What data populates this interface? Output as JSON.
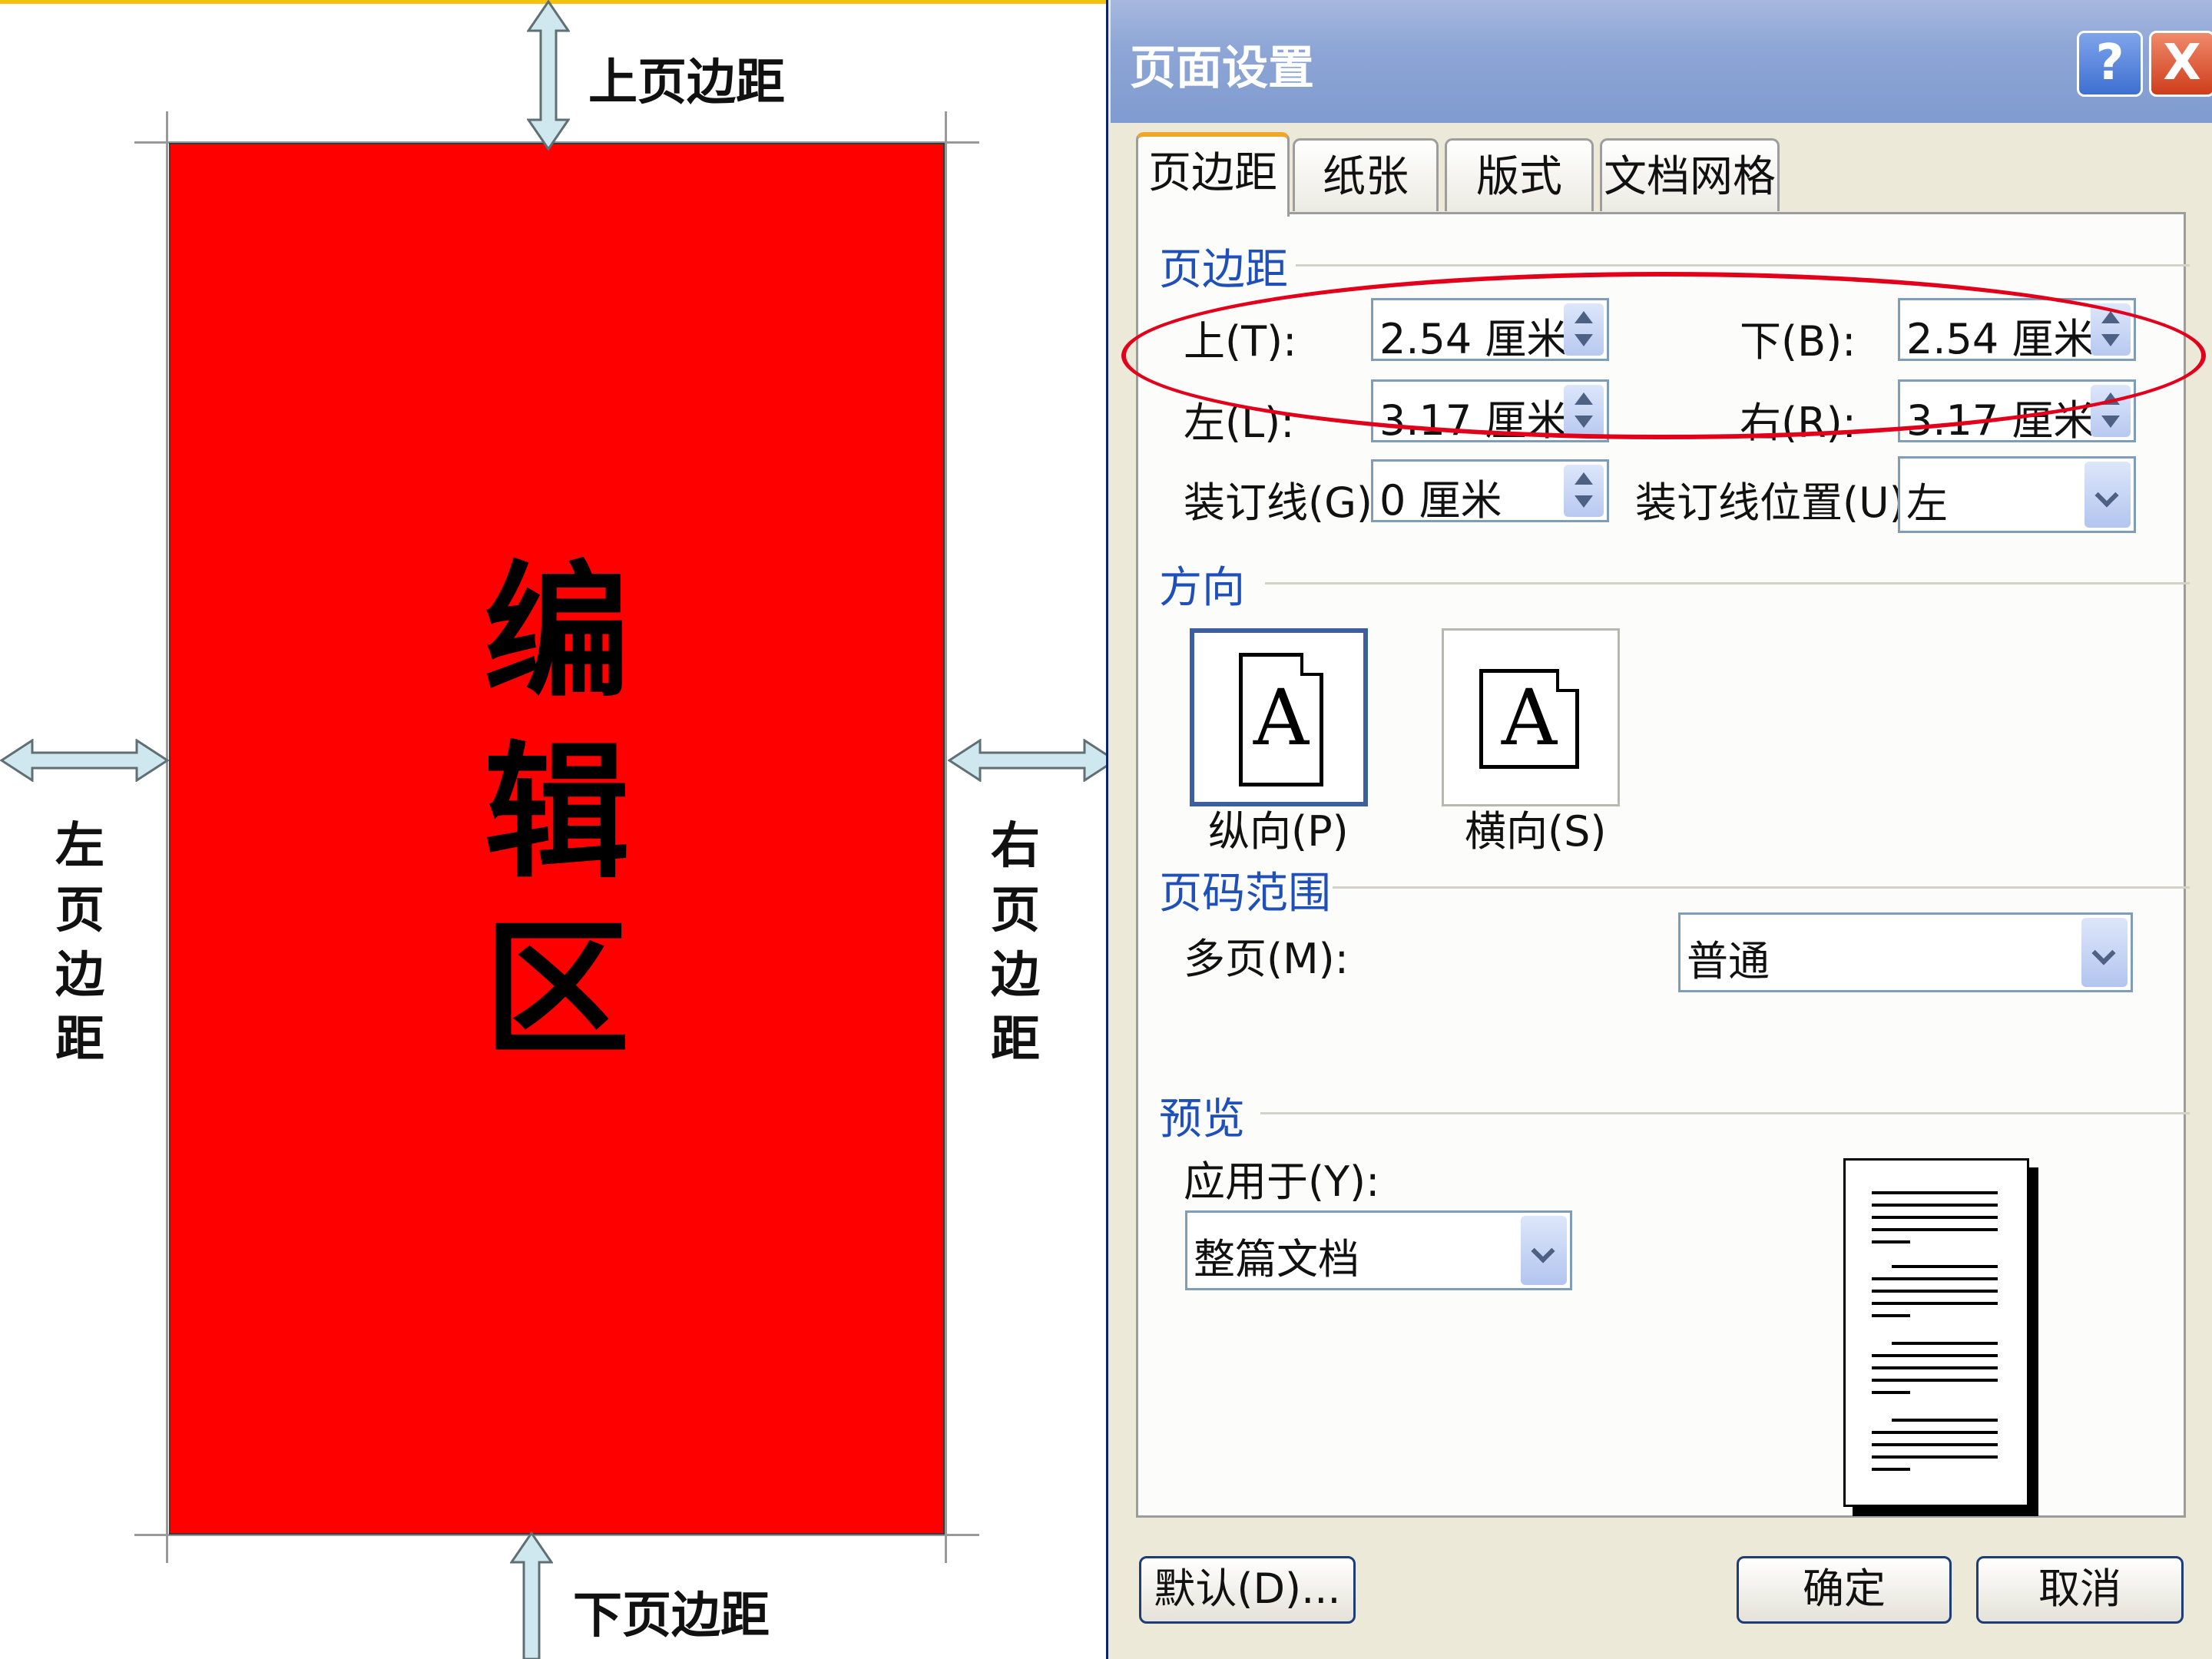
{
  "diagram": {
    "top_margin_label": "上页边距",
    "bottom_margin_label": "下页边距",
    "left_margin_label": "左页边距",
    "right_margin_label": "右页边距",
    "edit_area_chars": [
      "编",
      "辑",
      "区"
    ],
    "colors": {
      "edit_area": "#ff0000",
      "arrow_fill": "#cfe7ee",
      "top_accent": "#f4c20d"
    }
  },
  "dialog": {
    "title": "页面设置",
    "help_icon": "?",
    "close_icon": "X",
    "tabs": [
      {
        "label": "页边距",
        "active": true
      },
      {
        "label": "纸张",
        "active": false
      },
      {
        "label": "版式",
        "active": false
      },
      {
        "label": "文档网格",
        "active": false
      }
    ],
    "margins": {
      "section": "页边距",
      "top_label": "上(T):",
      "top_value": "2.54 厘米",
      "bottom_label": "下(B):",
      "bottom_value": "2.54 厘米",
      "left_label": "左(L):",
      "left_value": "3.17 厘米",
      "right_label": "右(R):",
      "right_value": "3.17 厘米",
      "gutter_label": "装订线(G):",
      "gutter_value": "0 厘米",
      "gutter_pos_label": "装订线位置(U):",
      "gutter_pos_value": "左"
    },
    "orientation": {
      "section": "方向",
      "portrait_label": "纵向(P)",
      "landscape_label": "横向(S)",
      "icon_letter": "A",
      "selected": "portrait"
    },
    "page_range": {
      "section": "页码范围",
      "multi_label": "多页(M):",
      "multi_value": "普通"
    },
    "preview": {
      "section": "预览",
      "apply_label": "应用于(Y):",
      "apply_value": "整篇文档"
    },
    "buttons": {
      "default": "默认(D)...",
      "ok": "确定",
      "cancel": "取消"
    },
    "highlight_color": "#e3001b"
  }
}
